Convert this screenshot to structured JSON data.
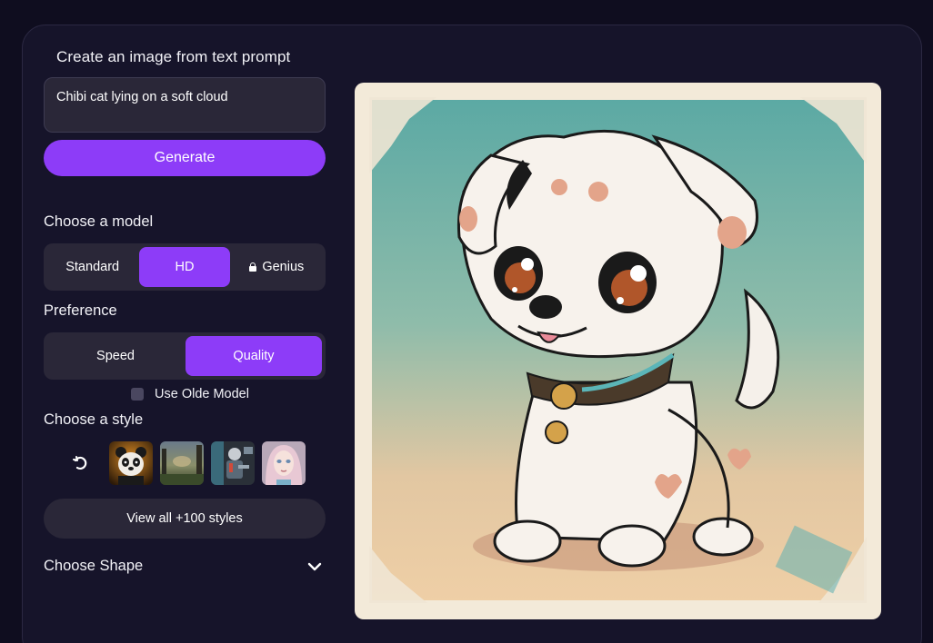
{
  "panel": {
    "title": "Create an image from text prompt",
    "prompt_value": "Chibi cat lying on a soft cloud",
    "generate_label": "Generate"
  },
  "model": {
    "label": "Choose a model",
    "options": [
      "Standard",
      "HD",
      "Genius"
    ],
    "selected": "HD",
    "locked": [
      "Genius"
    ]
  },
  "preference": {
    "label": "Preference",
    "options": [
      "Speed",
      "Quality"
    ],
    "selected": "Quality"
  },
  "old_model": {
    "label": "Use Olde Model",
    "checked": false
  },
  "style": {
    "label": "Choose a style",
    "thumbnails": [
      "none-style",
      "panda-style",
      "landscape-style",
      "cyberpunk-style",
      "portrait-style"
    ],
    "view_all_label": "View all +100 styles"
  },
  "shape": {
    "label": "Choose Shape",
    "expanded": false
  },
  "preview": {
    "description": "chibi white puppy with brown spots and teal collar on teal-to-beige background with white frame"
  },
  "colors": {
    "accent": "#8d3cf8",
    "panel": "#16142a",
    "control": "#2a2738",
    "page": "#0f0d1f"
  }
}
